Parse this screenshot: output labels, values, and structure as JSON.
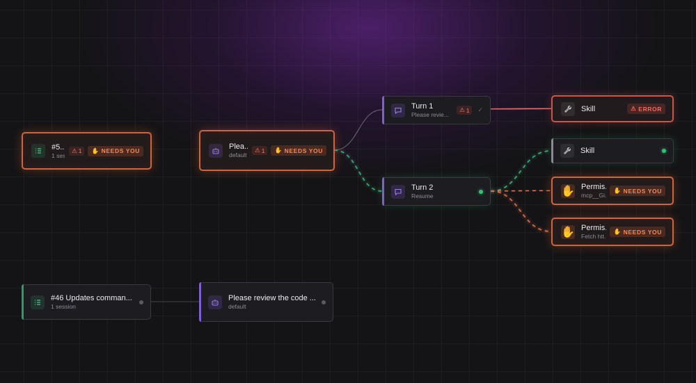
{
  "nodes": {
    "issue_active": {
      "title": "#5...",
      "subtitle": "1 ses...",
      "alert_count": "1",
      "status": "NEEDS YOU"
    },
    "session_active": {
      "title": "Plea...",
      "subtitle": "default",
      "alert_count": "1",
      "status": "NEEDS YOU"
    },
    "turn1": {
      "title": "Turn 1",
      "subtitle": "Please revie...",
      "alert_count": "1"
    },
    "turn2": {
      "title": "Turn 2",
      "subtitle": "Resume"
    },
    "skill_error": {
      "title": "Skill",
      "status": "ERROR"
    },
    "skill_ok": {
      "title": "Skill"
    },
    "perm1": {
      "title": "Permis...",
      "subtitle": "mcp__Gi...",
      "status": "NEEDS YOU"
    },
    "perm2": {
      "title": "Permis...",
      "subtitle": "Fetch htt...",
      "status": "NEEDS YOU"
    },
    "issue_idle": {
      "title": "#46 Updates comman...",
      "subtitle": "1 session"
    },
    "session_idle": {
      "title": "Please review the code ...",
      "subtitle": "default"
    }
  },
  "icons": {
    "issue": "issue-list-icon",
    "session": "robot-icon",
    "turn": "chat-bubble-icon",
    "skill": "wrench-icon",
    "permission": "hand-icon",
    "warning": "warning-triangle-icon",
    "needs_you": "hand-icon",
    "done": "check-icon"
  },
  "colors": {
    "needs_you": "#f08a5a",
    "error": "#f06b5e",
    "active_green": "#34c074",
    "issue_accent": "#2e9b6a",
    "session_accent": "#7e5fd6",
    "skill_accent": "#8a8a92",
    "link_orange": "#e0704a",
    "link_green": "#3fae78"
  }
}
